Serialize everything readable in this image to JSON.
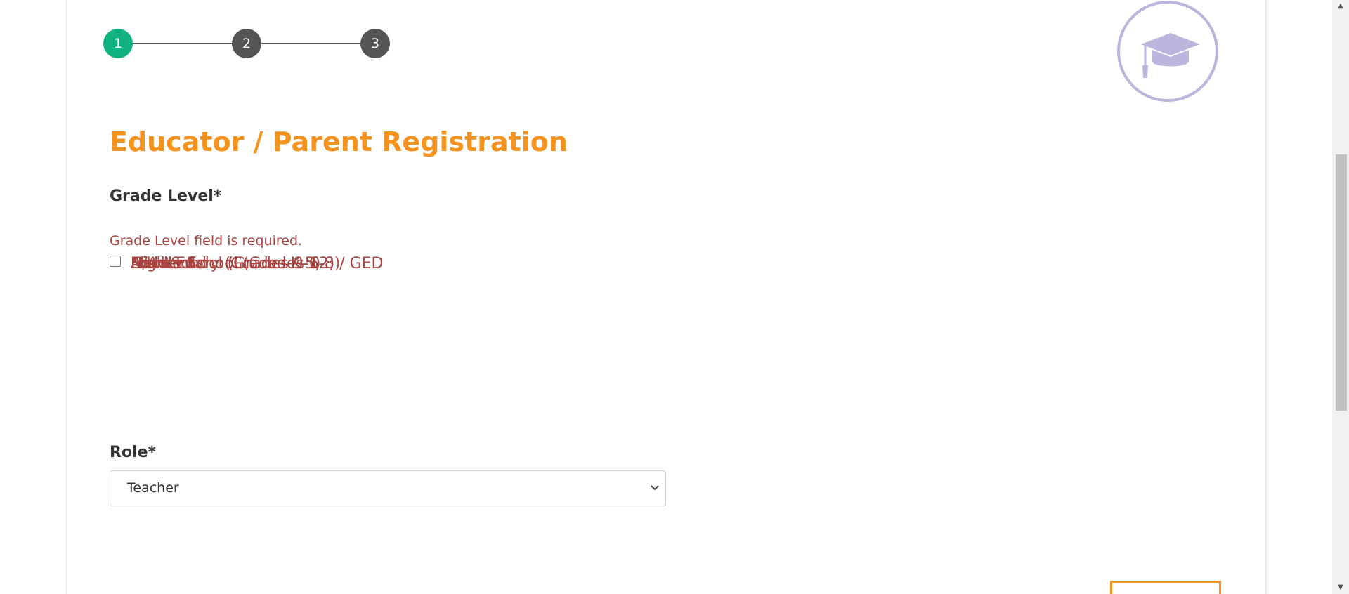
{
  "stepper": {
    "steps": [
      {
        "label": "1",
        "state": "active"
      },
      {
        "label": "2",
        "state": "pending"
      },
      {
        "label": "3",
        "state": "pending"
      }
    ],
    "active_color": "#10b27f",
    "pending_color": "#555555"
  },
  "emblem": {
    "icon": "graduation-cap-icon",
    "color": "#bcb5de"
  },
  "form": {
    "title": "Educator / Parent Registration",
    "grade_level": {
      "label": "Grade Level*",
      "error": "Grade Level field is required.",
      "options": [
        {
          "label": "Elementary (Grades K-5)",
          "checked": false
        },
        {
          "label": "Middle School (Grades 6-8)",
          "checked": false
        },
        {
          "label": "High School (Grades 9-12) / GED",
          "checked": false
        },
        {
          "label": "Higher Ed",
          "checked": false
        },
        {
          "label": "Adult Ed",
          "checked": false
        },
        {
          "label": "N/A",
          "checked": false
        }
      ]
    },
    "role": {
      "label": "Role*",
      "selected": "Teacher"
    }
  },
  "colors": {
    "title": "#f6921e",
    "error_text": "#a94442",
    "error_background": "#f2dede",
    "button_border": "#f6921e"
  },
  "scrollbar": {
    "up_icon": "scroll-up-arrow-icon",
    "down_icon": "scroll-down-arrow-icon"
  }
}
